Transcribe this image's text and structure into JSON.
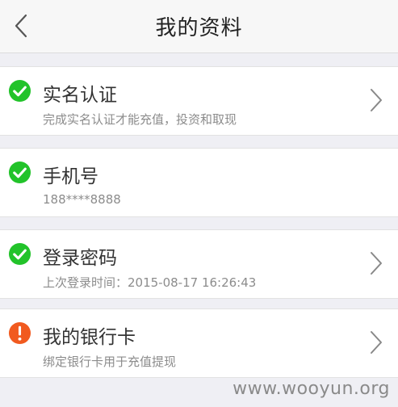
{
  "header": {
    "title": "我的资料",
    "back_icon": "chevron-left-icon"
  },
  "colors": {
    "verified": "#22c32a",
    "warning": "#f15a1f",
    "background": "#efeff4"
  },
  "rows": [
    {
      "title": "实名认证",
      "subtitle": "完成实名认证才能充值，投资和取现",
      "status": "verified",
      "status_icon": "check-circle-icon",
      "has_chevron": true
    },
    {
      "title": "手机号",
      "subtitle": "188****8888",
      "status": "verified",
      "status_icon": "check-circle-icon",
      "has_chevron": false
    },
    {
      "title": "登录密码",
      "subtitle": "上次登录时间：2015-08-17 16:26:43",
      "status": "verified",
      "status_icon": "check-circle-icon",
      "has_chevron": true
    },
    {
      "title": "我的银行卡",
      "subtitle": "绑定银行卡用于充值提现",
      "status": "warning",
      "status_icon": "exclamation-circle-icon",
      "has_chevron": true
    }
  ],
  "watermark": "www.wooyun.org"
}
